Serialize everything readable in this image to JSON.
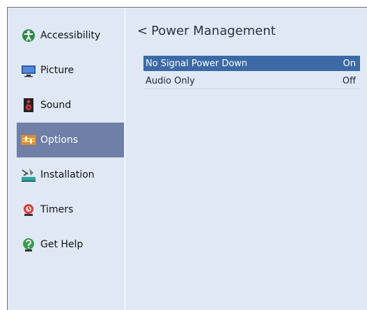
{
  "sidebar": {
    "items": [
      {
        "label": "Accessibility",
        "icon": "accessibility-icon"
      },
      {
        "label": "Picture",
        "icon": "tv-icon"
      },
      {
        "label": "Sound",
        "icon": "speaker-icon"
      },
      {
        "label": "Options",
        "icon": "options-icon",
        "selected": true
      },
      {
        "label": "Installation",
        "icon": "satellite-icon"
      },
      {
        "label": "Timers",
        "icon": "timer-icon"
      },
      {
        "label": "Get Help",
        "icon": "help-icon"
      }
    ]
  },
  "main": {
    "back_glyph": "<",
    "title": "Power Management",
    "settings": [
      {
        "label": "No Signal Power Down",
        "value": "On",
        "highlighted": true
      },
      {
        "label": "Audio Only",
        "value": "Off",
        "highlighted": false
      }
    ]
  },
  "colors": {
    "selected_nav": "#6f7fa8",
    "highlight_row": "#3b6aa5",
    "panel_bg": "#dfe8f4"
  }
}
